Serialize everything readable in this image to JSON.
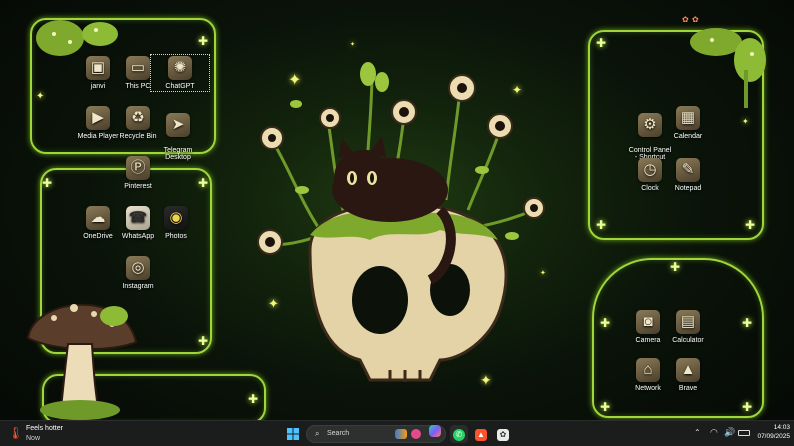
{
  "desktop_icons": {
    "janvi": "janvi",
    "this_pc": "This PC",
    "chatgpt": "ChatGPT",
    "media_player": "Media Player",
    "recycle_bin": "Recycle Bin",
    "telegram": "Telegram\nDesktop",
    "pinterest": "Pinterest",
    "onedrive": "OneDrive",
    "whatsapp": "WhatsApp",
    "photos": "Photos",
    "instagram": "Instagram",
    "control_panel": "Control Panel\n- Shortcut",
    "calendar": "Calendar",
    "clock": "Clock",
    "notepad": "Notepad",
    "camera": "Camera",
    "calculator": "Calculator",
    "network": "Network",
    "brave": "Brave"
  },
  "taskbar": {
    "weather_title": "Feels hotter",
    "weather_sub": "Now",
    "search_placeholder": "Search",
    "time": "14:03",
    "date": "07/09/2025"
  },
  "colors": {
    "frame": "#9fd63a",
    "taskbar": "#1b1d1c",
    "accent": "#c7ff4a"
  }
}
